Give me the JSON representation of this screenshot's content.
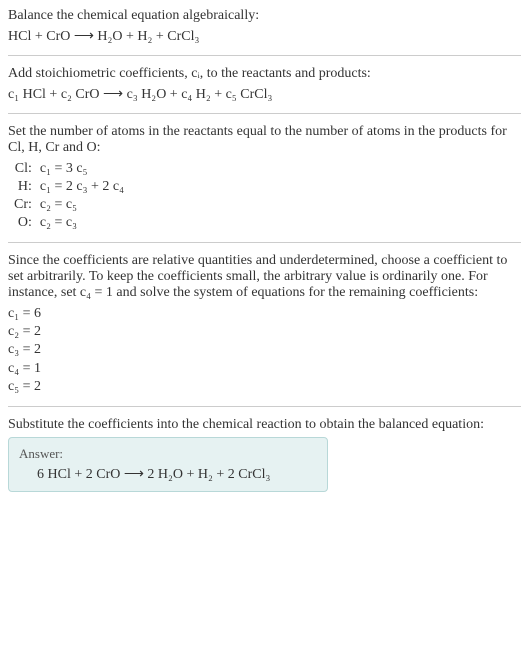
{
  "intro1": "Balance the chemical equation algebraically:",
  "eq1": "HCl + CrO ⟶ H₂O + H₂ + CrCl₃",
  "intro2": "Add stoichiometric coefficients, cᵢ, to the reactants and products:",
  "eq2": "c₁ HCl + c₂ CrO ⟶ c₃ H₂O + c₄ H₂ + c₅ CrCl₃",
  "intro3": "Set the number of atoms in the reactants equal to the number of atoms in the products for Cl, H, Cr and O:",
  "atom_eqs": [
    {
      "el": "Cl:",
      "rel": "c₁ = 3 c₅"
    },
    {
      "el": "H:",
      "rel": "c₁ = 2 c₃ + 2 c₄"
    },
    {
      "el": "Cr:",
      "rel": "c₂ = c₅"
    },
    {
      "el": "O:",
      "rel": "c₂ = c₃"
    }
  ],
  "intro4": "Since the coefficients are relative quantities and underdetermined, choose a coefficient to set arbitrarily. To keep the coefficients small, the arbitrary value is ordinarily one. For instance, set c₄ = 1 and solve the system of equations for the remaining coefficients:",
  "solved": [
    "c₁ = 6",
    "c₂ = 2",
    "c₃ = 2",
    "c₄ = 1",
    "c₅ = 2"
  ],
  "intro5": "Substitute the coefficients into the chemical reaction to obtain the balanced equation:",
  "answer_label": "Answer:",
  "answer_eq": "6 HCl + 2 CrO ⟶ 2 H₂O + H₂ + 2 CrCl₃",
  "chart_data": {
    "type": "table",
    "equation_unbalanced": "HCl + CrO -> H2O + H2 + CrCl3",
    "coefficients": {
      "c1": 6,
      "c2": 2,
      "c3": 2,
      "c4": 1,
      "c5": 2
    },
    "atom_balance": {
      "Cl": "c1 = 3 c5",
      "H": "c1 = 2 c3 + 2 c4",
      "Cr": "c2 = c5",
      "O": "c2 = c3"
    },
    "equation_balanced": "6 HCl + 2 CrO -> 2 H2O + H2 + 2 CrCl3"
  }
}
